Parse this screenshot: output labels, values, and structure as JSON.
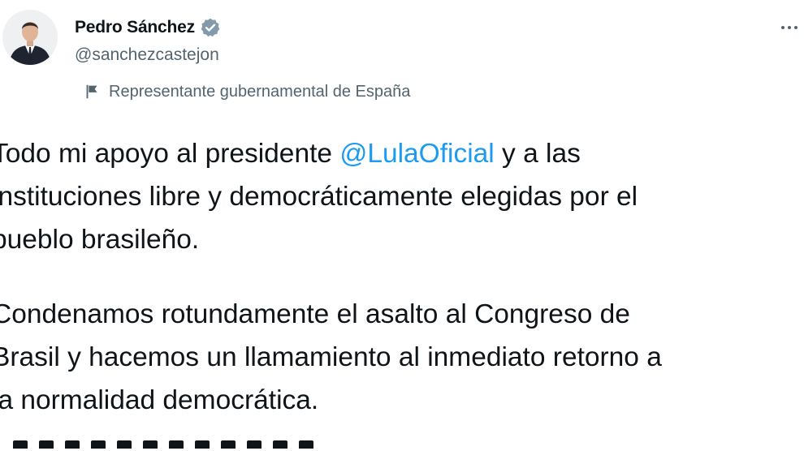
{
  "author": {
    "display_name": "Pedro Sánchez",
    "handle": "@sanchezcastejon",
    "label": "Representante gubernamental de España"
  },
  "icons": {
    "verified": "verified-badge-icon",
    "label_flag": "flag-icon",
    "more": "more-options-icon"
  },
  "colors": {
    "mention": "#1d9bf0",
    "secondary_text": "#536471",
    "primary_text": "#0f1419"
  },
  "tweet": {
    "paragraph1": {
      "line1_pre": "Todo mi apoyo al presidente ",
      "line1_mention": "@LulaOficial",
      "line1_post": " y a las",
      "line2": "instituciones libre y democráticamente elegidas por el",
      "line3": "pueblo brasileño."
    },
    "paragraph2": {
      "line1": "Condenamos rotundamente el asalto al Congreso de",
      "line2": "Brasil y hacemos un llamamiento al inmediato retorno a",
      "line3": "la normalidad democrática."
    }
  }
}
